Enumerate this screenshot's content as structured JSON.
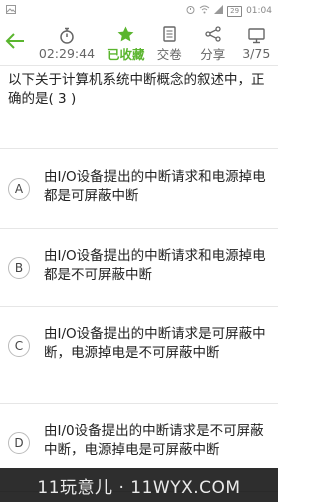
{
  "status_bar": {
    "left_icon": "image-icon",
    "battery": "29",
    "time": "01:04"
  },
  "toolbar": {
    "back_icon": "back-arrow-icon",
    "timer": "02:29:44",
    "favorite": "已收藏",
    "submit": "交卷",
    "share": "分享",
    "progress": "3/75"
  },
  "question": {
    "text": "以下关于计算机系统中断概念的叙述中，正确的是( 3 )"
  },
  "options": [
    {
      "letter": "A",
      "text": "由I/O设备提出的中断请求和电源掉电都是可屏蔽中断"
    },
    {
      "letter": "B",
      "text": "由I/O设备提出的中断请求和电源掉电都是不可屏蔽中断"
    },
    {
      "letter": "C",
      "text": "由I/O设备提出的中断请求是可屏蔽中断，电源掉电是不可屏蔽中断"
    },
    {
      "letter": "D",
      "text": "由I/0设备提出的中断请求是不可屏蔽中断，电源掉电是可屏蔽中断"
    }
  ],
  "watermark": "11玩意儿 · 11WYX.COM",
  "colors": {
    "accent": "#5ab52e",
    "divider": "#e6e6e6"
  }
}
